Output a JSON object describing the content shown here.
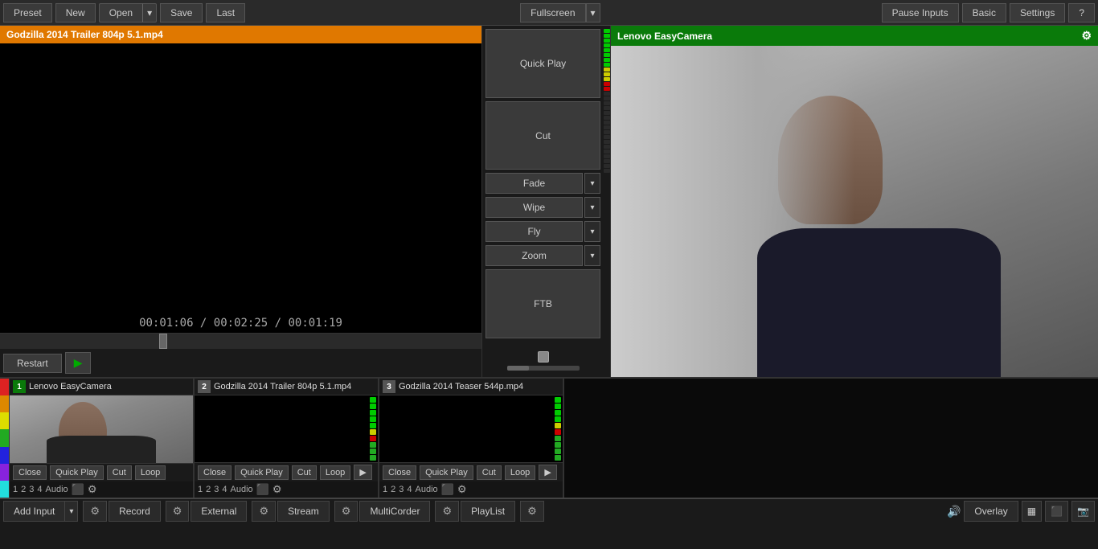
{
  "topbar": {
    "preset_label": "Preset",
    "new_label": "New",
    "open_label": "Open",
    "open_arrow": "▾",
    "save_label": "Save",
    "last_label": "Last",
    "fullscreen_label": "Fullscreen",
    "fullscreen_arrow": "▾",
    "pause_inputs_label": "Pause Inputs",
    "basic_label": "Basic",
    "settings_label": "Settings",
    "help_label": "?"
  },
  "preview": {
    "title": "Godzilla 2014 Trailer 804p 5.1.mp4",
    "timecode": "00:01:06  /  00:02:25  /  00:01:19",
    "restart_label": "Restart",
    "play_icon": "▶"
  },
  "transitions": {
    "quick_play_label": "Quick Play",
    "cut_label": "Cut",
    "fade_label": "Fade",
    "fade_arrow": "▾",
    "wipe_label": "Wipe",
    "wipe_arrow": "▾",
    "fly_label": "Fly",
    "fly_arrow": "▾",
    "zoom_label": "Zoom",
    "zoom_arrow": "▾",
    "ftb_label": "FTB"
  },
  "camera": {
    "title": "Lenovo EasyCamera",
    "gear_icon": "⚙"
  },
  "sources": [
    {
      "num": "1",
      "active": true,
      "title": "Lenovo EasyCamera",
      "type": "camera",
      "close_label": "Close",
      "quick_play_label": "Quick Play",
      "cut_label": "Cut",
      "loop_label": "Loop",
      "n1": "1",
      "n2": "2",
      "n3": "3",
      "n4": "4",
      "audio_label": "Audio"
    },
    {
      "num": "2",
      "active": false,
      "title": "Godzilla 2014 Trailer 804p 5.1.mp4",
      "type": "video",
      "close_label": "Close",
      "quick_play_label": "Quick Play",
      "cut_label": "Cut",
      "loop_label": "Loop",
      "arrow": "▶",
      "n1": "1",
      "n2": "2",
      "n3": "3",
      "n4": "4",
      "audio_label": "Audio"
    },
    {
      "num": "3",
      "active": false,
      "title": "Godzilla 2014 Teaser 544p.mp4",
      "type": "video",
      "close_label": "Close",
      "quick_play_label": "Quick Play",
      "cut_label": "Cut",
      "loop_label": "Loop",
      "arrow": "▶",
      "n1": "1",
      "n2": "2",
      "n3": "3",
      "n4": "4",
      "audio_label": "Audio"
    }
  ],
  "bottombar": {
    "add_input_label": "Add Input",
    "add_input_arrow": "▾",
    "gear_icon": "⚙",
    "record_label": "Record",
    "record_gear": "⚙",
    "external_label": "External",
    "external_gear": "⚙",
    "stream_label": "Stream",
    "stream_gear": "⚙",
    "multicorder_label": "MultiCorder",
    "multicorder_gear": "⚙",
    "playlist_label": "PlayList",
    "playlist_gear": "⚙",
    "vol_icon": "🔊",
    "overlay_label": "Overlay",
    "grid_icon": "▦",
    "monitor_icon": "⬛",
    "camera_icon": "📷"
  }
}
